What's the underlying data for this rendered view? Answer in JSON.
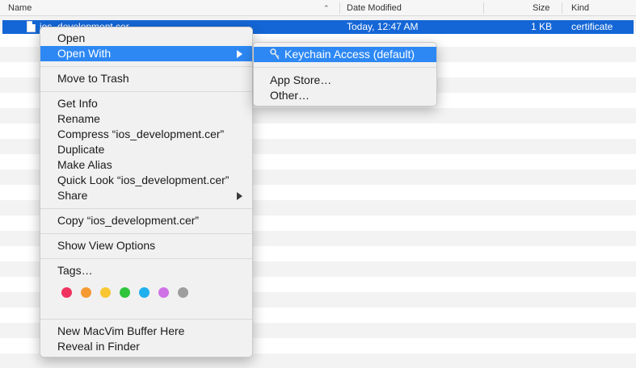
{
  "header": {
    "name": "Name",
    "date_modified": "Date Modified",
    "size": "Size",
    "kind": "Kind"
  },
  "file": {
    "name": "ios_development.cer",
    "date_modified": "Today, 12:47 AM",
    "size": "1 KB",
    "kind": "certificate"
  },
  "context_menu": {
    "open": "Open",
    "open_with": "Open With",
    "move_to_trash": "Move to Trash",
    "get_info": "Get Info",
    "rename": "Rename",
    "compress": "Compress “ios_development.cer”",
    "duplicate": "Duplicate",
    "make_alias": "Make Alias",
    "quick_look": "Quick Look “ios_development.cer”",
    "share": "Share",
    "copy": "Copy “ios_development.cer”",
    "show_view_options": "Show View Options",
    "tags": "Tags…",
    "tag_colors": [
      "#f0325e",
      "#f59a32",
      "#f7c632",
      "#2ec53c",
      "#1fb0ee",
      "#cf72e6",
      "#9e9e9e"
    ],
    "new_macvim_buffer": "New MacVim Buffer Here",
    "reveal_in_finder": "Reveal in Finder"
  },
  "open_with_submenu": {
    "keychain_access": "Keychain Access (default)",
    "app_store": "App Store…",
    "other": "Other…"
  },
  "colors": {
    "selection": "#1466d6",
    "menu_highlight": "#2d88f4"
  }
}
